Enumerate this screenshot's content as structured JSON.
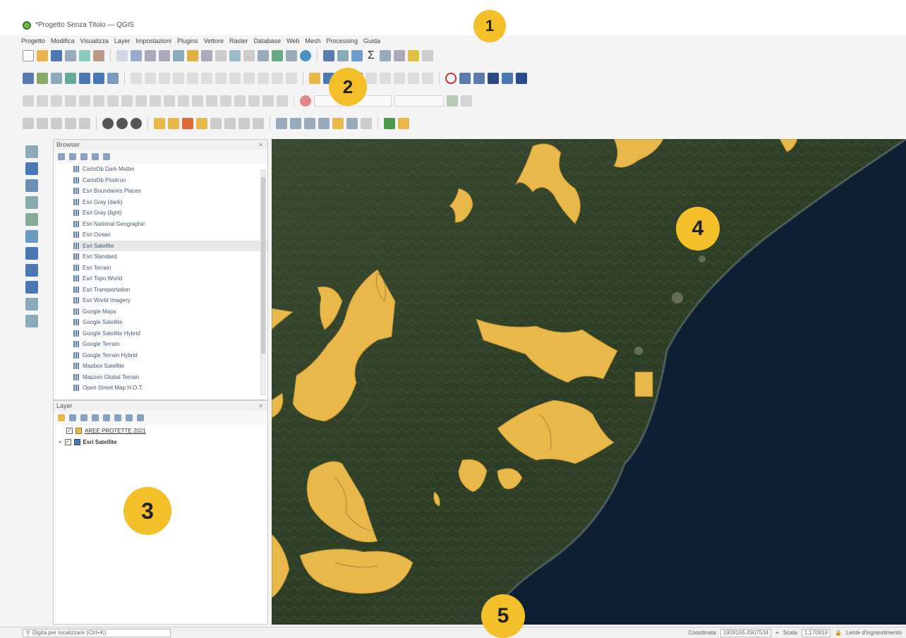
{
  "window": {
    "title": "*Progetto Senza Titolo — QGIS"
  },
  "menu": [
    "Progetto",
    "Modifica",
    "Visualizza",
    "Layer",
    "Impostazioni",
    "Plugins",
    "Vettore",
    "Raster",
    "Database",
    "Web",
    "Mesh",
    "Processing",
    "Guida"
  ],
  "browser": {
    "title": "Browser",
    "items": [
      "CartoDb Dark Matter",
      "CartoDb Positron",
      "Esri Boundaries Places",
      "Esri Gray (dark)",
      "Esri Gray (light)",
      "Esri National Geographic",
      "Esri Ocean",
      "Esri Satellite",
      "Esri Standard",
      "Esri Terrain",
      "Esri Topo World",
      "Esri Transportation",
      "Esri World Imagery",
      "Google Maps",
      "Google Satellite",
      "Google Satellite Hybrid",
      "Google Terrain",
      "Google Terrain Hybrid",
      "Mapbox Satellite",
      "Mapzen Global Terrain",
      "Open Street Map H.O.T."
    ],
    "selected_index": 7
  },
  "layers": {
    "title": "Layer",
    "items": [
      {
        "name": "AREE PROTETTE 2021",
        "checked": true,
        "color": "#e8b84a"
      },
      {
        "name": "Esri Satellite",
        "checked": true
      }
    ]
  },
  "status": {
    "locator_placeholder": "Digita per localizzare (Ctrl+K)",
    "coordinate_label": "Coordinata",
    "coordinate_value": "1909165,4907534",
    "scale_label": "Scala",
    "scale_value": "1:170819",
    "magnifier_label": "Lente d'ingrandimento"
  },
  "badges": [
    "1",
    "2",
    "3",
    "4",
    "5"
  ],
  "colors": {
    "protected_area": "#e8b84a",
    "badge": "#f4c02a",
    "sea": "#0e1f33",
    "land": "#2f4128"
  }
}
